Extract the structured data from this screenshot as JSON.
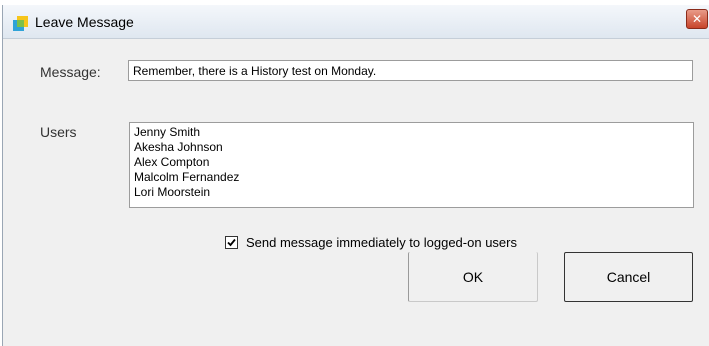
{
  "window": {
    "title": "Leave Message",
    "close_symbol": "✕",
    "icon": "app-icon"
  },
  "form": {
    "message_label": "Message:",
    "message_value": "Remember, there is a History test on Monday.",
    "users_label": "Users",
    "users": [
      "Jenny Smith",
      "Akesha Johnson",
      "Alex Compton",
      "Malcolm Fernandez",
      "Lori Moorstein"
    ],
    "send_checkbox_label": "Send message immediately to logged-on users",
    "send_checkbox_checked": true
  },
  "buttons": {
    "ok_label": "OK",
    "cancel_label": "Cancel"
  },
  "colors": {
    "close_button": "#c8452b",
    "dialog_background": "#f0f0f0"
  }
}
